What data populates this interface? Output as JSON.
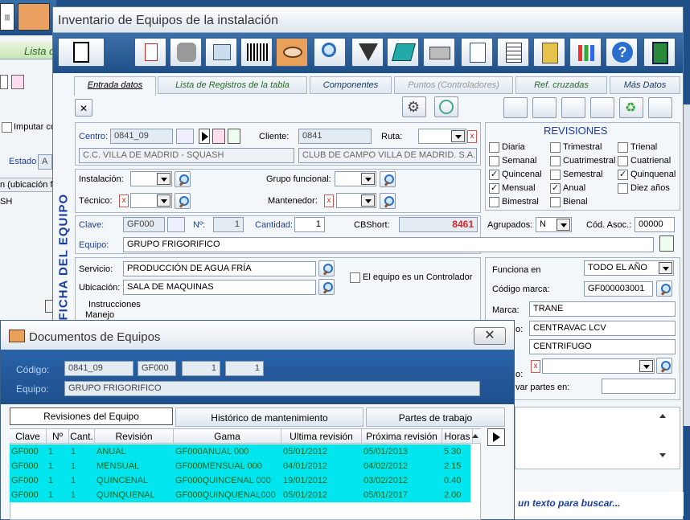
{
  "back_window": {
    "tab_label": "Lista d",
    "imputar_label": "Imputar co",
    "estado_label": "Estado",
    "estado_value": "A",
    "header_text": "n (ubicación f",
    "row_text": "SH"
  },
  "main_window": {
    "title": "Inventario de Equipos de la instalación",
    "tabs": [
      "Entrada datos",
      "Lista de Registros de la tabla",
      "Componentes",
      "Puntos (Controladores)",
      "Ref. cruzadas",
      "Más Datos"
    ],
    "side_label": "FICHA DEL EQUIPO",
    "centro_label": "Centro:",
    "centro_value": "0841_09",
    "cliente_label": "Cliente:",
    "cliente_value": "0841",
    "ruta_label": "Ruta:",
    "centro_name": "C.C. VILLA DE MADRID - SQUASH",
    "cliente_name": "CLUB DE CAMPO VILLA DE MADRID. S.A.",
    "instalacion_label": "Instalación:",
    "grupo_label": "Grupo funcional:",
    "tecnico_label": "Técnico:",
    "mantenedor_label": "Mantenedor:",
    "clave_label": "Clave:",
    "clave_value": "GF000",
    "n_label": "Nº:",
    "n_value": "1",
    "cantidad_label": "Cantidad:",
    "cantidad_value": "1",
    "cbshort_label": "CBShort:",
    "cbshort_value": "8461",
    "agrupados_label": "Agrupados:",
    "agrupados_value": "N",
    "cod_asoc_label": "Cód. Asoc.:",
    "cod_asoc_value": "00000",
    "equipo_label": "Equipo:",
    "equipo_value": "GRUPO FRIGORIFICO",
    "servicio_label": "Servicio:",
    "servicio_value": "PRODUCCIÓN DE AGUA FRÍA",
    "ubicacion_label": "Ubicación:",
    "ubicacion_value": "SALA DE MAQUINAS",
    "controlador_label": "El equipo es un Controlador",
    "instrucciones_label": "Instrucciones",
    "manejo_label": "Manejo",
    "revisiones": {
      "title": "REVISIONES",
      "items": [
        {
          "label": "Diaria",
          "checked": false
        },
        {
          "label": "Trimestral",
          "checked": false
        },
        {
          "label": "Trienal",
          "checked": false
        },
        {
          "label": "Semanal",
          "checked": false
        },
        {
          "label": "Cuatrimestral",
          "checked": false
        },
        {
          "label": "Cuatrienal",
          "checked": false
        },
        {
          "label": "Quincenal",
          "checked": true
        },
        {
          "label": "Semestral",
          "checked": false
        },
        {
          "label": "Quinquenal",
          "checked": true
        },
        {
          "label": "Mensual",
          "checked": true
        },
        {
          "label": "Anual",
          "checked": true
        },
        {
          "label": "Diez años",
          "checked": false
        },
        {
          "label": "Bimestral",
          "checked": false
        },
        {
          "label": "Bienal",
          "checked": false
        }
      ]
    },
    "funciona_label": "Funciona en",
    "funciona_value": "TODO EL AÑO",
    "codigo_marca_label": "Código marca:",
    "codigo_marca_value": "GF000003001",
    "marca_label": "Marca:",
    "marca_value": "TRANE",
    "modelo_label": "o:",
    "modelo_value": "CENTRAVAC LCV",
    "tipo_value": "CENTRIFUGO",
    "extra_label": "o:",
    "partes_label": "var partes en:",
    "search_hint": "un texto para buscar..."
  },
  "doc_window": {
    "title": "Documentos de Equipos",
    "codigo_label": "Código:",
    "codigo_value": "0841_09",
    "codigo_clave": "GF000",
    "codigo_n": "1",
    "codigo_cant": "1",
    "equipo_label": "Equipo:",
    "equipo_value": "GRUPO FRIGORIFICO",
    "tabs": [
      "Revisiones del Equipo",
      "Histórico de mantenimiento",
      "Partes de trabajo"
    ],
    "columns": [
      "Clave",
      "Nº",
      "Cant.",
      "Revisión",
      "Gama",
      "Ultima revisión",
      "Próxima revisión",
      "Horas"
    ],
    "rows": [
      [
        "GF000",
        "1",
        "1",
        "ANUAL",
        "GF000ANUAL    000",
        "05/01/2012",
        "05/01/2013",
        "5.30"
      ],
      [
        "GF000",
        "1",
        "1",
        "MENSUAL",
        "GF000MENSUAL   000",
        "04/01/2012",
        "04/02/2012",
        "2.15"
      ],
      [
        "GF000",
        "1",
        "1",
        "QUINCENAL",
        "GF000QUINCENAL 000",
        "19/01/2012",
        "03/02/2012",
        "0.40"
      ],
      [
        "GF000",
        "1",
        "1",
        "QUINQUENAL",
        "GF000QUINQUENAL000",
        "05/01/2012",
        "05/01/2017",
        "2.00"
      ]
    ]
  },
  "colors": {
    "desktop": "#1e4f86",
    "grid_highlight": "#00e5ee",
    "title_blue": "#1a3ea0"
  }
}
